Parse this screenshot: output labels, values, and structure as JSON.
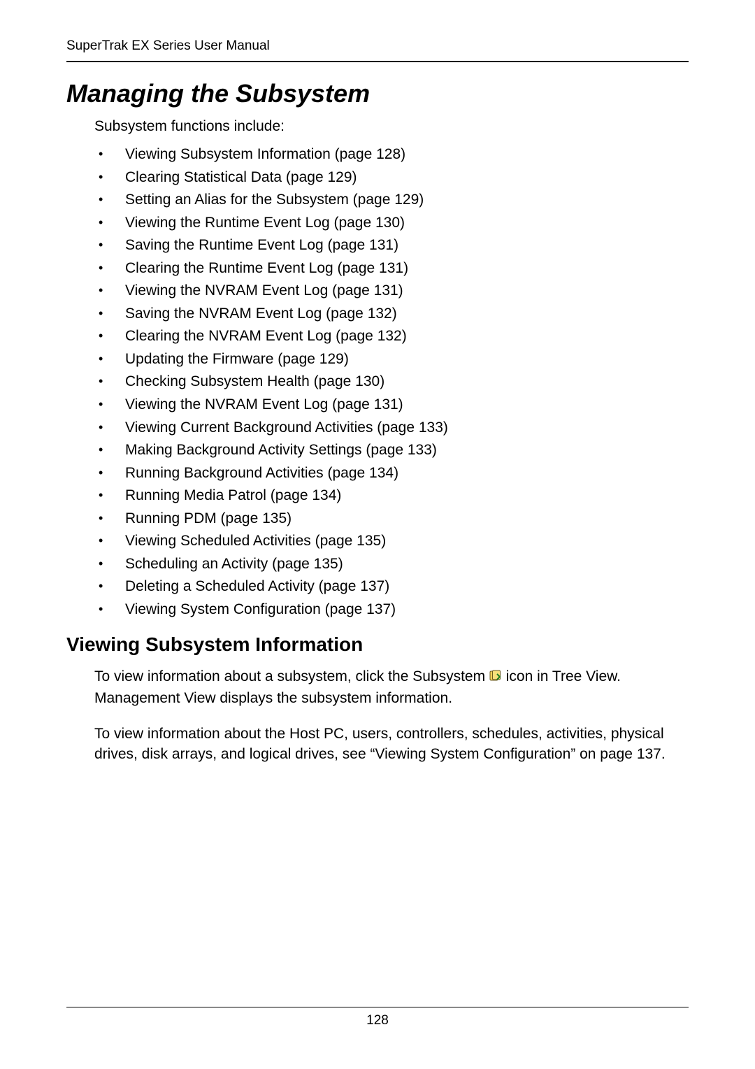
{
  "header": {
    "running_title": "SuperTrak EX Series User Manual"
  },
  "title": "Managing the Subsystem",
  "intro": "Subsystem functions include:",
  "toc": [
    "Viewing Subsystem Information (page 128)",
    "Clearing Statistical Data (page 129)",
    "Setting an Alias for the Subsystem (page 129)",
    "Viewing the Runtime Event Log (page 130)",
    "Saving the Runtime Event Log (page 131)",
    "Clearing the Runtime Event Log (page 131)",
    "Viewing the NVRAM Event Log (page 131)",
    "Saving the NVRAM Event Log (page 132)",
    "Clearing the NVRAM Event Log (page 132)",
    "Updating the Firmware (page 129)",
    "Checking Subsystem Health (page 130)",
    "Viewing the NVRAM Event Log (page 131)",
    "Viewing Current Background Activities (page 133)",
    "Making Background Activity Settings (page 133)",
    "Running Background Activities (page 134)",
    "Running Media Patrol (page 134)",
    "Running PDM (page 135)",
    "Viewing Scheduled Activities (page 135)",
    "Scheduling an Activity (page 135)",
    "Deleting a Scheduled Activity (page 137)",
    "Viewing System Configuration (page 137)"
  ],
  "section_heading": "Viewing Subsystem Information",
  "para1_pre": "To view information about a subsystem, click the Subsystem ",
  "para1_post": " icon in Tree View. Management View displays the subsystem information.",
  "para2": "To view information about the Host PC, users, controllers, schedules, activities, physical drives, disk arrays, and logical drives, see “Viewing System Configuration” on page 137.",
  "page_number": "128"
}
